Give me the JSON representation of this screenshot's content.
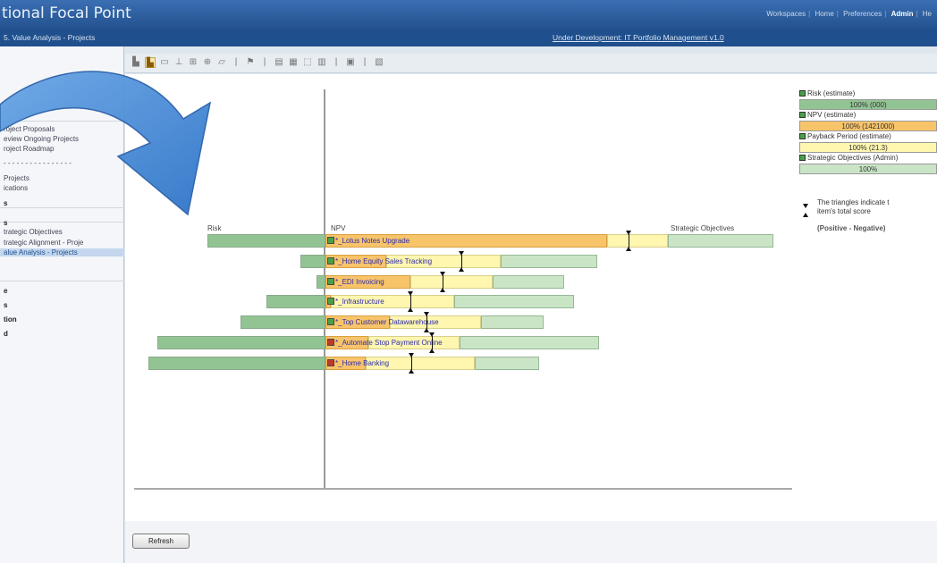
{
  "app_title": "tional Focal Point",
  "top_nav": [
    "Workspaces",
    "Home",
    "Preferences",
    "Admin",
    "He"
  ],
  "breadcrumb": "5. Value Analysis - Projects",
  "context_link": "Under Development: IT Portfolio Management v1.0",
  "sidebar": {
    "items": [
      {
        "label": "roject Proposals",
        "top": 140
      },
      {
        "label": "eview Ongoing Projects",
        "top": 151
      },
      {
        "label": "roject Roadmap",
        "top": 162
      },
      {
        "label": "- - - - - - - - - - - - - - - -",
        "top": 178
      },
      {
        "label": "Projects",
        "top": 195
      },
      {
        "label": "ications",
        "top": 206
      },
      {
        "label": "s",
        "top": 223,
        "bold": true
      },
      {
        "label": "s",
        "top": 245,
        "bold": true
      },
      {
        "label": "trategic Objectives",
        "top": 255
      },
      {
        "label": "trategic Alignment - Proje",
        "top": 267
      },
      {
        "label": "alue Analysis - Projects",
        "top": 278,
        "active": true
      },
      {
        "label": "e",
        "top": 321,
        "bold": true
      },
      {
        "label": "s",
        "top": 337,
        "bold": true
      },
      {
        "label": "tion",
        "top": 353,
        "bold": true
      },
      {
        "label": "d",
        "top": 369,
        "bold": true
      }
    ]
  },
  "chart_data": {
    "type": "bar",
    "title": "",
    "columns": [
      "Risk",
      "NPV",
      "Strategic Objectives"
    ],
    "series": [
      {
        "name": "Risk (estimate)",
        "color": "#92c493"
      },
      {
        "name": "NPV (estimate)",
        "color": "#f8c46a"
      },
      {
        "name": "Payback Period (estimate)",
        "color": "#fff6b0"
      },
      {
        "name": "Strategic Objectives (Admin)",
        "color": "#c9e5c6"
      }
    ],
    "projects": [
      {
        "name": "Lotus Notes Upgrade",
        "status": "green",
        "risk": 132,
        "npv": 315,
        "pay": 68,
        "strat": 118
      },
      {
        "name": "Home Equity Sales Tracking",
        "status": "green",
        "risk": 28,
        "npv": 68,
        "pay": 128,
        "strat": 108
      },
      {
        "name": "EDI Invoicing",
        "status": "green",
        "risk": 10,
        "npv": 95,
        "pay": 92,
        "strat": 80
      },
      {
        "name": "Infrastructure",
        "status": "green",
        "risk": 66,
        "npv": 6,
        "pay": 138,
        "strat": 134
      },
      {
        "name": "Top Customer Datawarehouse",
        "status": "green",
        "risk": 95,
        "npv": 72,
        "pay": 102,
        "strat": 70
      },
      {
        "name": "Automate Stop Payment Online",
        "status": "red",
        "risk": 188,
        "npv": 48,
        "pay": 102,
        "strat": 156
      },
      {
        "name": "Home Banking",
        "status": "red",
        "risk": 198,
        "npv": 45,
        "pay": 122,
        "strat": 72
      }
    ]
  },
  "legend": {
    "items": [
      {
        "label": "Risk (estimate)",
        "bar": "100% (000)",
        "color": "#92c493"
      },
      {
        "label": "NPV (estimate)",
        "bar": "100% (1421000)",
        "color": "#f8c46a"
      },
      {
        "label": "Payback Period (estimate)",
        "bar": "100% (21.3)",
        "color": "#fff6b0"
      },
      {
        "label": "Strategic Objectives (Admin)",
        "bar": "100%",
        "color": "#c9e5c6"
      }
    ],
    "note_line1": "The triangles indicate t",
    "note_line2": "item's total score",
    "note_line3": "(Positive - Negative)"
  },
  "refresh_label": "Refresh"
}
